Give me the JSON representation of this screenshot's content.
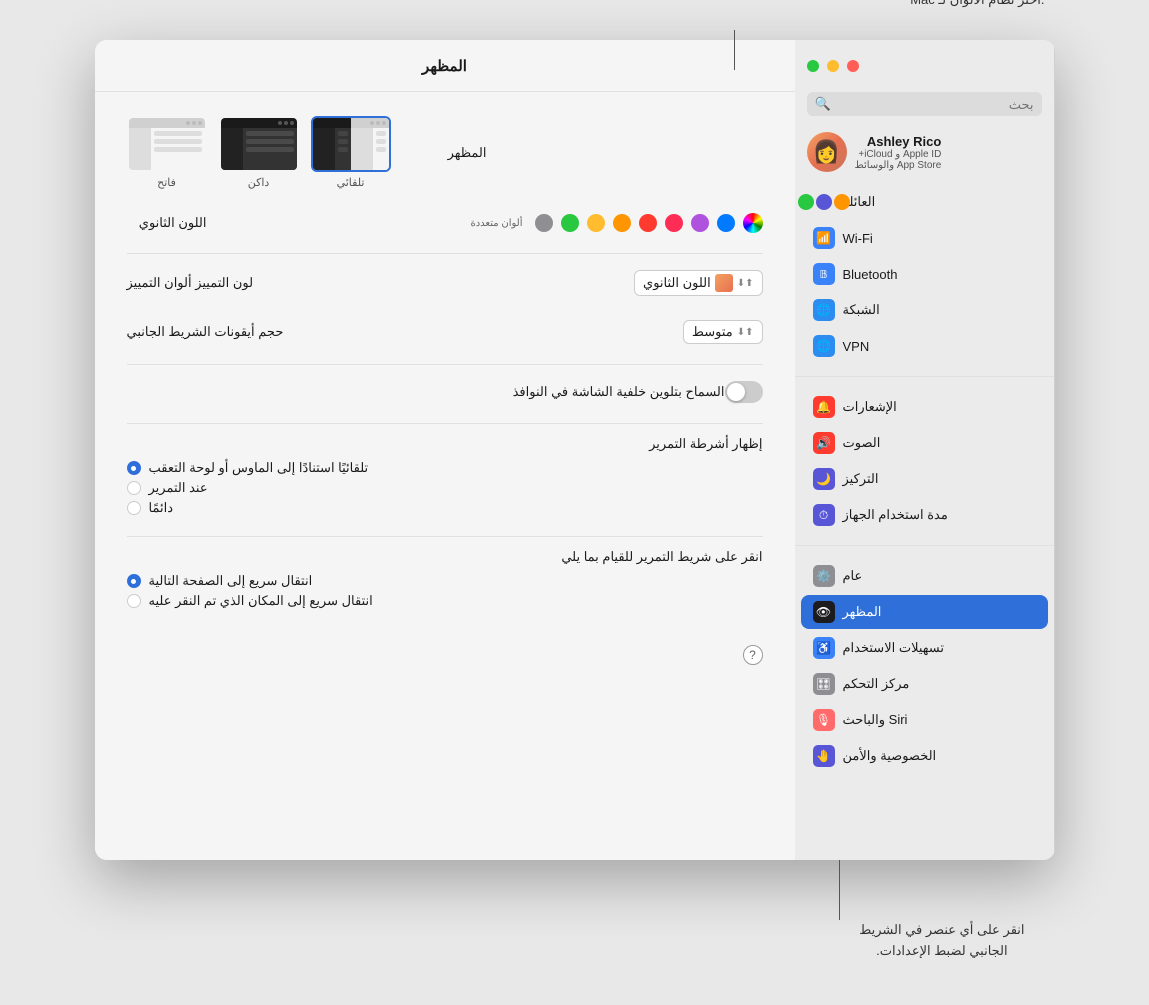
{
  "annotations": {
    "top": ".اختر نظام الألوان لـ Mac",
    "bottom_line1": "انقر على أي عنصر في الشريط",
    "bottom_line2": "الجانبي لضبط الإعدادات."
  },
  "window": {
    "title": "المظهر",
    "main_title": "المظهر"
  },
  "search": {
    "placeholder": "بحث"
  },
  "user": {
    "name": "Ashley Rico",
    "sub1": "Apple ID و iCloud+",
    "sub2": "App Store والوسائط"
  },
  "sidebar": {
    "items": [
      {
        "id": "family",
        "label": "العائلة",
        "icon": "family"
      },
      {
        "id": "wifi",
        "label": "Wi-Fi",
        "icon": "wifi"
      },
      {
        "id": "bluetooth",
        "label": "Bluetooth",
        "icon": "bluetooth"
      },
      {
        "id": "network",
        "label": "الشبكة",
        "icon": "network"
      },
      {
        "id": "vpn",
        "label": "VPN",
        "icon": "vpn"
      },
      {
        "id": "notifications",
        "label": "الإشعارات",
        "icon": "notifications"
      },
      {
        "id": "sound",
        "label": "الصوت",
        "icon": "sound"
      },
      {
        "id": "focus",
        "label": "التركيز",
        "icon": "focus"
      },
      {
        "id": "screentime",
        "label": "مدة استخدام الجهاز",
        "icon": "screentime"
      },
      {
        "id": "general",
        "label": "عام",
        "icon": "general"
      },
      {
        "id": "appearance",
        "label": "المظهر",
        "icon": "appearance",
        "active": true
      },
      {
        "id": "accessibility",
        "label": "تسهيلات الاستخدام",
        "icon": "accessibility"
      },
      {
        "id": "control",
        "label": "مركز التحكم",
        "icon": "control"
      },
      {
        "id": "siri",
        "label": "Siri والباحث",
        "icon": "siri"
      },
      {
        "id": "privacy",
        "label": "الخصوصية والأمن",
        "icon": "privacy"
      }
    ]
  },
  "content": {
    "appearance_label": "المظهر",
    "options": [
      {
        "id": "light",
        "label": "فاتح",
        "selected": false
      },
      {
        "id": "dark",
        "label": "داكن",
        "selected": false
      },
      {
        "id": "auto",
        "label": "تلقائي",
        "selected": true
      }
    ],
    "accent_color_label": "اللون الثانوي",
    "multicolor_label": "ألوان متعددة",
    "highlight_label": "لون التمييز ألوان التمييز",
    "highlight_value": "اللون الثانوي",
    "sidebar_icon_size_label": "حجم أيقونات الشريط الجانبي",
    "sidebar_icon_size_value": "متوسط",
    "allow_wallpaper_label": "السماح بتلوين خلفية الشاشة في النوافذ",
    "scrollbar_title": "إظهار أشرطة التمرير",
    "scrollbar_options": [
      {
        "id": "auto",
        "label": "تلقائيًا استنادًا إلى الماوس أو لوحة التعقب",
        "selected": true
      },
      {
        "id": "scrolling",
        "label": "عند التمرير",
        "selected": false
      },
      {
        "id": "always",
        "label": "دائمًا",
        "selected": false
      }
    ],
    "click_scrollbar_title": "انقر على شريط التمرير للقيام بما يلي",
    "click_options": [
      {
        "id": "next_page",
        "label": "انتقال سريع إلى الصفحة التالية",
        "selected": true
      },
      {
        "id": "click_location",
        "label": "انتقال سريع إلى المكان الذي تم النقر عليه",
        "selected": false
      }
    ]
  },
  "colors": {
    "swatches": [
      {
        "id": "graphite",
        "color": "#8e8e93"
      },
      {
        "id": "green",
        "color": "#28c840"
      },
      {
        "id": "yellow",
        "color": "#febc2e"
      },
      {
        "id": "orange",
        "color": "#ff9500"
      },
      {
        "id": "red",
        "color": "#ff3b30"
      },
      {
        "id": "pink",
        "color": "#ff2d55"
      },
      {
        "id": "purple",
        "color": "#af52de"
      },
      {
        "id": "blue",
        "color": "#007aff"
      },
      {
        "id": "multicolor",
        "special": "multicolor"
      }
    ]
  }
}
